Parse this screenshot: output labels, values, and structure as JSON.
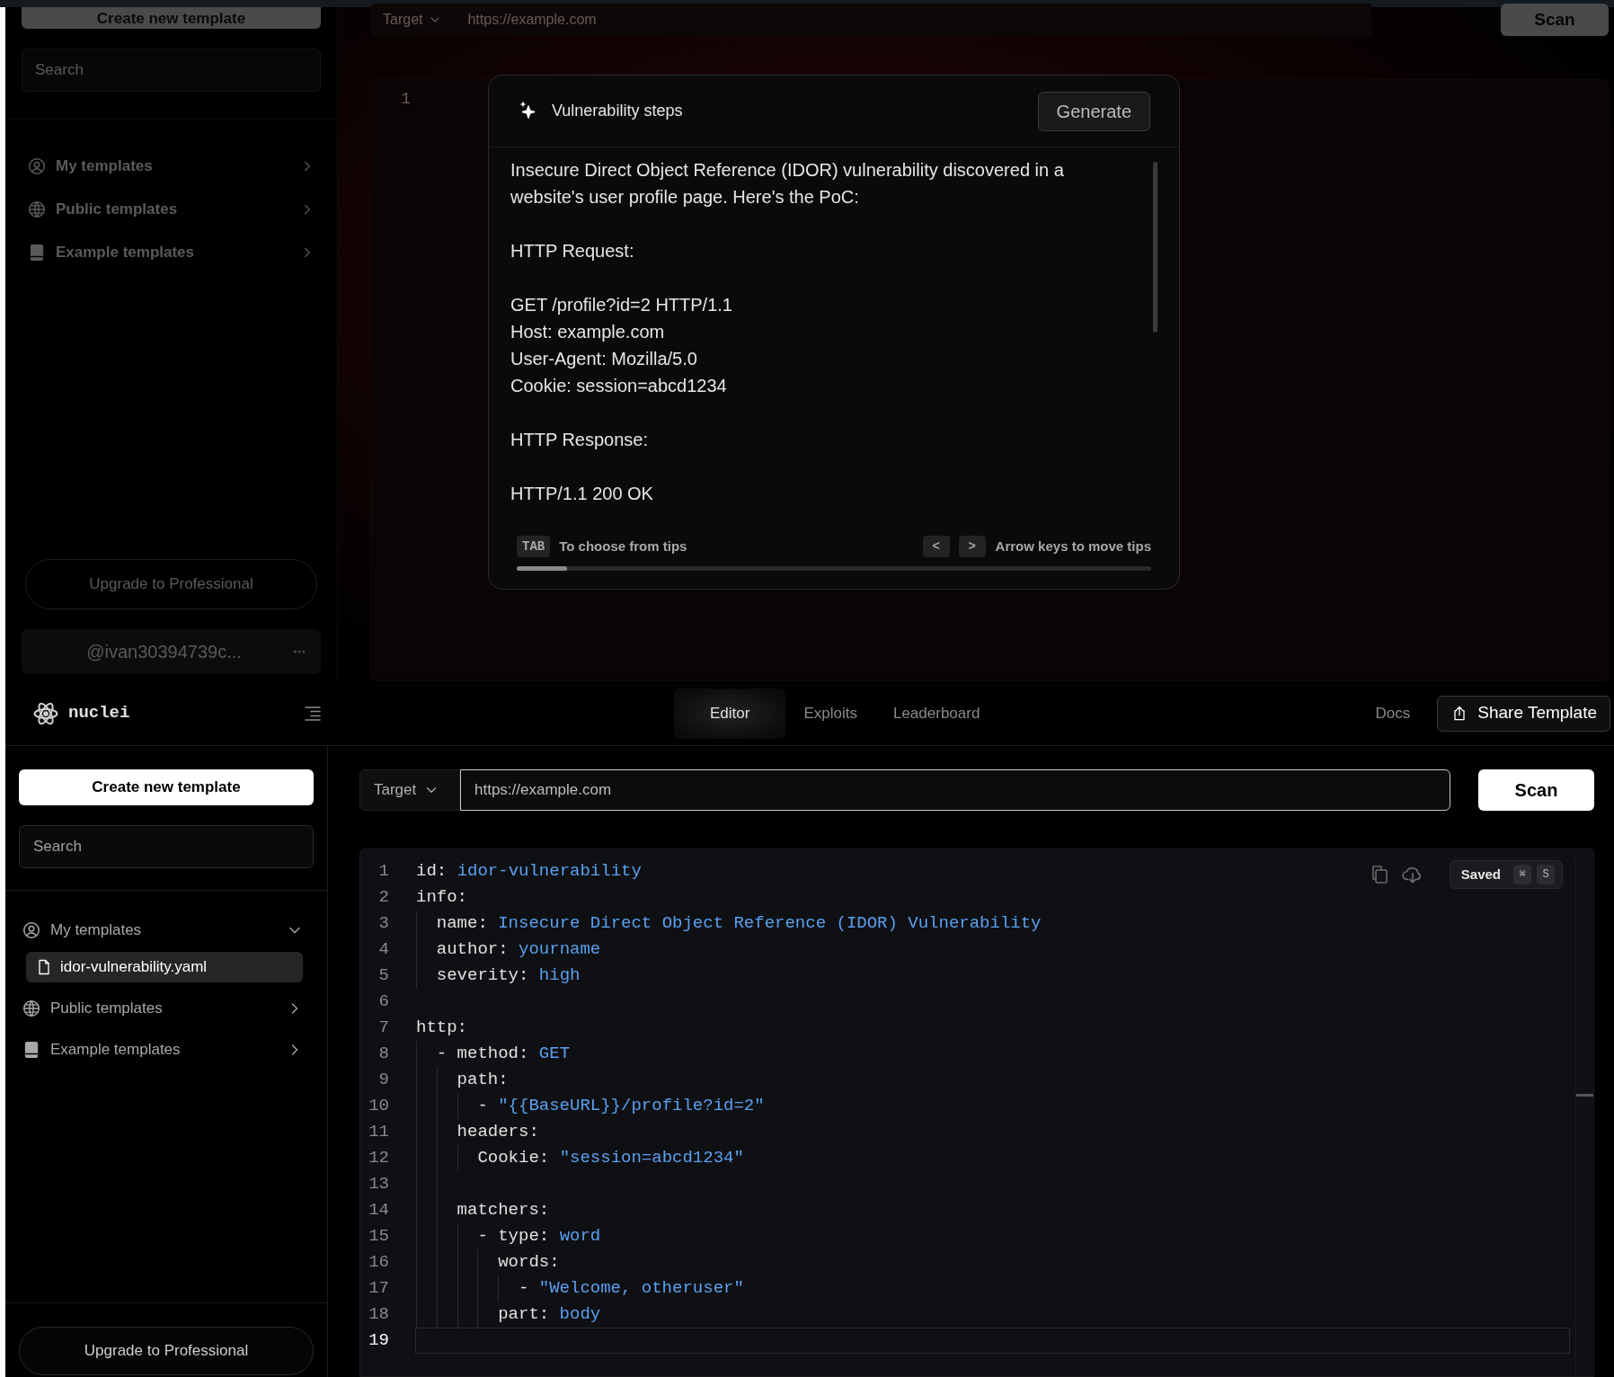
{
  "background_screen": {
    "sidebar": {
      "create_button": "Create new template",
      "search": {
        "placeholder": "Search"
      },
      "items": [
        {
          "kind": "user",
          "label": "My templates",
          "expanded": false
        },
        {
          "kind": "globe",
          "label": "Public templates",
          "expanded": false
        },
        {
          "kind": "book",
          "label": "Example templates",
          "expanded": false
        }
      ],
      "upgrade_button": "Upgrade to Professional",
      "account": {
        "username": "@ivan30394739c..."
      }
    },
    "toolbar": {
      "target": "Target",
      "url": "https://example.com",
      "scan_button": "Scan"
    },
    "editor": {
      "line_numbers": [
        "1"
      ]
    }
  },
  "dialog": {
    "title": "Vulnerability steps",
    "generate_button": "Generate",
    "paragraphs": [
      [
        "Insecure Direct Object Reference (IDOR) vulnerability discovered in a website's user profile page. Here's the PoC:"
      ],
      [
        "HTTP Request:"
      ],
      [
        "GET /profile?id=2 HTTP/1.1",
        "Host: example.com",
        "User-Agent: Mozilla/5.0",
        "Cookie: session=abcd1234"
      ],
      [
        "HTTP Response:"
      ],
      [
        "HTTP/1.1 200 OK"
      ]
    ],
    "footer": {
      "tab_key": "TAB",
      "tab_hint": "To choose from tips",
      "prev_key": "<",
      "next_key": ">",
      "arrow_hint": "Arrow keys to move tips",
      "progress": {
        "level": 0.08
      }
    }
  },
  "header": {
    "logo": "nuclei",
    "tabs": [
      {
        "label": "Editor",
        "selected": true
      },
      {
        "label": "Exploits",
        "selected": false
      },
      {
        "label": "Leaderboard",
        "selected": false
      }
    ],
    "docs_link": "Docs",
    "share_button": "Share Template"
  },
  "sidebar": {
    "create_button": "Create new template",
    "search": {
      "placeholder": "Search"
    },
    "items": [
      {
        "kind": "user",
        "label": "My templates",
        "expanded": true,
        "children": [
          {
            "label": "idor-vulnerability.yaml",
            "selected": true
          }
        ]
      },
      {
        "kind": "globe",
        "label": "Public templates",
        "expanded": false
      },
      {
        "kind": "book",
        "label": "Example templates",
        "expanded": false
      }
    ],
    "upgrade_button": "Upgrade to Professional"
  },
  "toolbar": {
    "target": "Target",
    "url": "https://example.com",
    "scan_button": "Scan"
  },
  "editor": {
    "status": "Saved",
    "shortcut": [
      "⌘",
      "S"
    ],
    "lines": [
      {
        "number": "1",
        "key": "id:",
        "value": "idor-vulnerability",
        "active": false
      },
      {
        "number": "2",
        "key": "info:",
        "active": false,
        "children": [
          {
            "number": "3",
            "key": "name:",
            "value": "Insecure Direct Object Reference (IDOR) Vulnerability",
            "active": false
          },
          {
            "number": "4",
            "key": "author:",
            "value": "yourname",
            "active": false
          },
          {
            "number": "5",
            "key": "severity:",
            "value": "high",
            "active": false
          }
        ]
      },
      {
        "number": "6",
        "active": false
      },
      {
        "number": "7",
        "key": "http:",
        "active": false,
        "children": [
          {
            "number": "8",
            "key": "- method:",
            "value": "GET",
            "active": false,
            "children": [
              {
                "number": "9",
                "key": "path:",
                "active": false,
                "children": [
                  {
                    "number": "10",
                    "key": "-",
                    "value": "\"{{BaseURL}}/profile?id=2\"",
                    "active": false
                  }
                ]
              },
              {
                "number": "11",
                "key": "headers:",
                "active": false,
                "children": [
                  {
                    "number": "12",
                    "key": "Cookie:",
                    "value": "\"session=abcd1234\"",
                    "active": false
                  }
                ]
              },
              {
                "number": "13",
                "active": false
              },
              {
                "number": "14",
                "key": "matchers:",
                "active": false,
                "children": [
                  {
                    "number": "15",
                    "key": "- type:",
                    "value": "word",
                    "active": false,
                    "children": [
                      {
                        "number": "16",
                        "key": "words:",
                        "active": false,
                        "children": [
                          {
                            "number": "17",
                            "key": "-",
                            "value": "\"Welcome, otheruser\"",
                            "active": false
                          }
                        ]
                      },
                      {
                        "number": "18",
                        "key": "part:",
                        "value": "body",
                        "active": false
                      }
                    ]
                  }
                ]
              }
            ]
          }
        ]
      },
      {
        "number": "19",
        "active": true
      }
    ]
  }
}
